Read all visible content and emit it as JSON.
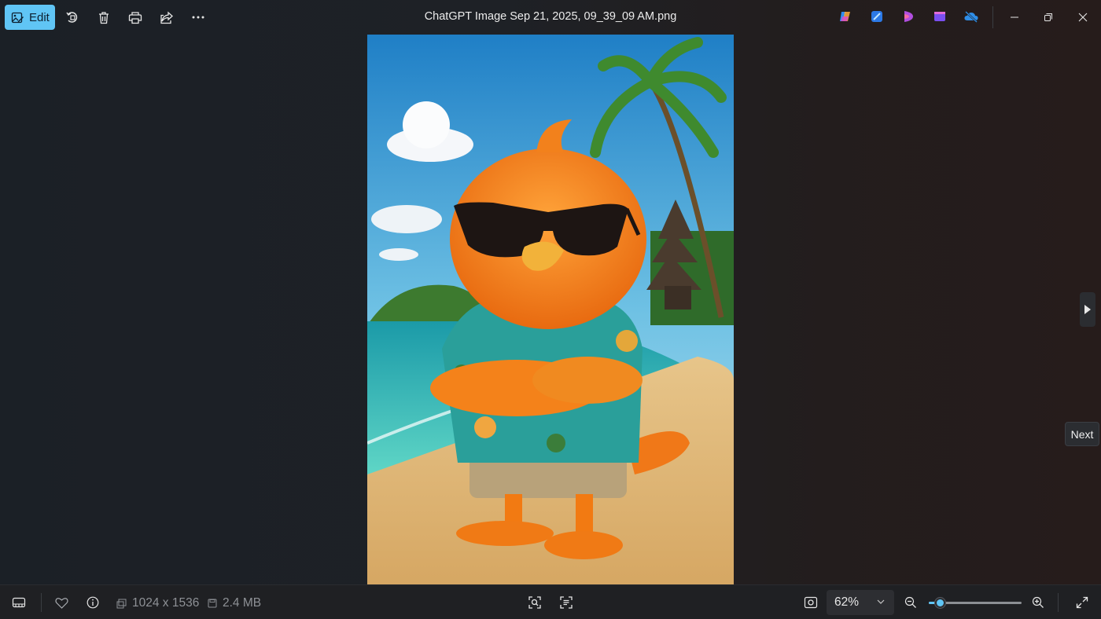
{
  "toolbar": {
    "edit_label": "Edit",
    "tools": [
      "rotate-icon",
      "delete-icon",
      "print-icon",
      "share-icon",
      "more-icon"
    ]
  },
  "window": {
    "title": "ChatGPT Image Sep 21, 2025, 09_39_09 AM.png",
    "app_icons": [
      "copilot-icon",
      "designer-icon",
      "clipchamp-icon",
      "movie-icon",
      "onedrive-icon"
    ]
  },
  "navigation": {
    "next_tooltip": "Next"
  },
  "statusbar": {
    "dimensions": "1024 x 1536",
    "file_size": "2.4 MB",
    "zoom": "62%",
    "zoom_level_fraction": 0.12
  },
  "colors": {
    "accent": "#60c5f5",
    "topbar_bg": "#1e2126",
    "bottombar_bg": "#1f2023"
  }
}
